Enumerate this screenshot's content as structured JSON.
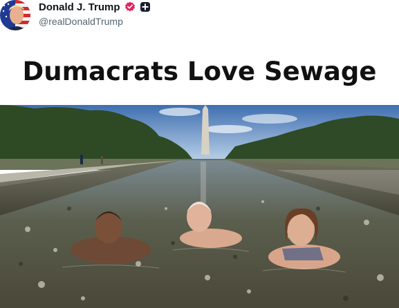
{
  "post": {
    "display_name": "Donald J. Trump",
    "handle": "@realDonaldTrump",
    "verified_icon": "verified-badge-icon",
    "affiliate_icon": "affiliate-badge-icon",
    "avatar_icon": "avatar-flag-portrait"
  },
  "meme": {
    "title": "Dumacrats Love Sewage",
    "photo_description_icon": "reflecting-pool-photo"
  },
  "colors": {
    "name_text": "#0f1419",
    "handle_text": "#536471",
    "verified_badge": "#e0245e",
    "title_text": "#111111"
  }
}
